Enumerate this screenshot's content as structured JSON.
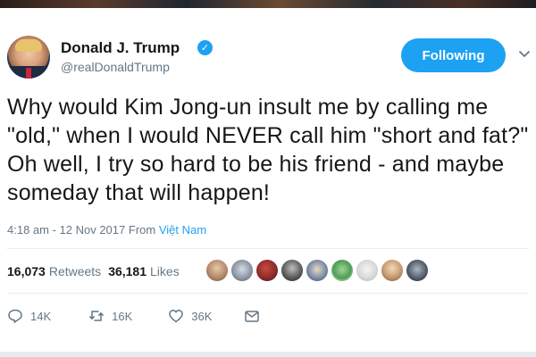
{
  "tweet": {
    "author": {
      "display_name": "Donald J. Trump",
      "handle": "@realDonaldTrump",
      "verified": true
    },
    "follow_button_label": "Following",
    "text": "Why would Kim Jong-un insult me by calling me \"old,\" when I would NEVER call him \"short and fat?\" Oh well, I try so hard to be his friend - and maybe someday that will happen!",
    "timestamp": "4:18 am - 12 Nov 2017",
    "from_label": "From",
    "location": "Việt Nam",
    "stats": {
      "retweets_count": "16,073",
      "retweets_label": "Retweets",
      "likes_count": "36,181",
      "likes_label": "Likes"
    },
    "actions": {
      "reply_count": "14K",
      "retweet_count": "16K",
      "like_count": "36K"
    }
  },
  "colors": {
    "accent": "#1da1f2",
    "text": "#14171a",
    "muted": "#657786",
    "divider": "#e6ecf0"
  },
  "icons": [
    "verified-badge-icon",
    "chevron-down-icon",
    "reply-icon",
    "retweet-icon",
    "heart-icon",
    "envelope-icon"
  ]
}
